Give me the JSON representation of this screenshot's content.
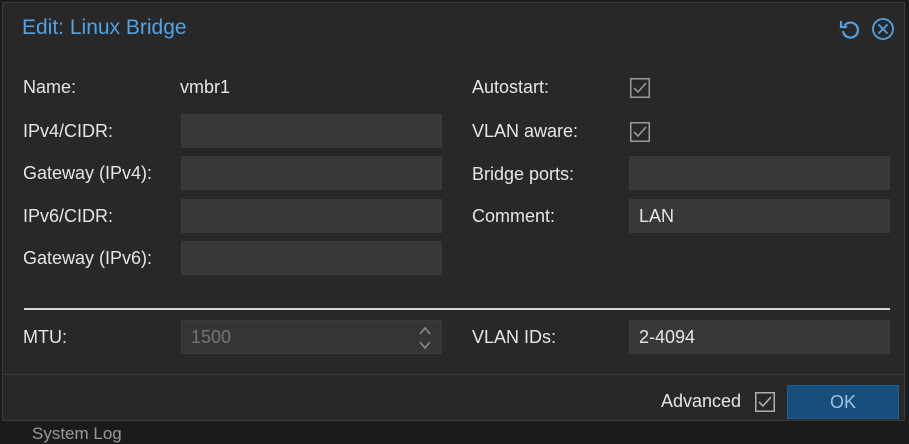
{
  "background": {
    "partial_text": "System Log"
  },
  "dialog": {
    "title": "Edit: Linux Bridge",
    "tools": {
      "reset_icon": "reset-icon",
      "close_icon": "close-icon"
    }
  },
  "left": {
    "name_label": "Name:",
    "name_value": "vmbr1",
    "ipv4_label": "IPv4/CIDR:",
    "ipv4_value": "",
    "gw4_label": "Gateway (IPv4):",
    "gw4_value": "",
    "ipv6_label": "IPv6/CIDR:",
    "ipv6_value": "",
    "gw6_label": "Gateway (IPv6):",
    "gw6_value": "",
    "mtu_label": "MTU:",
    "mtu_placeholder": "1500"
  },
  "right": {
    "autostart_label": "Autostart:",
    "autostart_checked": true,
    "vlan_aware_label": "VLAN aware:",
    "vlan_aware_checked": true,
    "bridge_ports_label": "Bridge ports:",
    "bridge_ports_value": "",
    "comment_label": "Comment:",
    "comment_value": "LAN",
    "vlan_ids_label": "VLAN IDs:",
    "vlan_ids_value": "2-4094"
  },
  "footer": {
    "advanced_label": "Advanced",
    "advanced_checked": true,
    "ok_label": "OK"
  },
  "colors": {
    "accent": "#4fa3e6",
    "ok_button_bg": "#174e7b",
    "dialog_bg": "#282828",
    "field_bg": "#383838"
  }
}
